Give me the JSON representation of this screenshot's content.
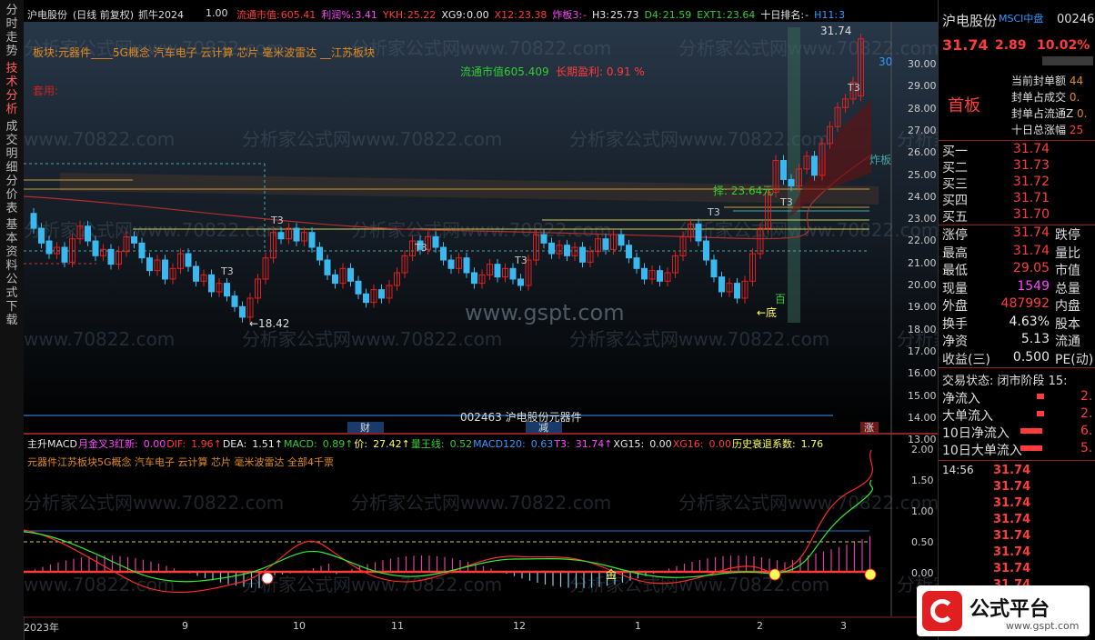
{
  "stock": {
    "name": "沪电股份",
    "code": "002463",
    "period": "(日线 前复权)",
    "indicator": "抓牛2024",
    "ratio": "1.00"
  },
  "header": {
    "items": [
      {
        "t": "流通市值:",
        "c": "#ff3c3c"
      },
      {
        "t": "605.41",
        "c": "#ff3c3c"
      },
      {
        "t": "利润%:",
        "c": "#ff44ff"
      },
      {
        "t": "3.41",
        "c": "#ff44ff"
      },
      {
        "t": "YKH:",
        "c": "#ff3c3c"
      },
      {
        "t": "25.22",
        "c": "#ff3c3c"
      },
      {
        "t": "XG9:",
        "c": "#e8e8e8"
      },
      {
        "t": "0.00",
        "c": "#e8e8e8"
      },
      {
        "t": "X12:",
        "c": "#ff3c3c"
      },
      {
        "t": "23.38",
        "c": "#ff3c3c"
      },
      {
        "t": "炸板3:",
        "c": "#ff44ff"
      },
      {
        "t": "-",
        "c": "#ff44ff"
      },
      {
        "t": "H3:",
        "c": "#e8e8e8"
      },
      {
        "t": "25.73",
        "c": "#e8e8e8"
      },
      {
        "t": "D4:",
        "c": "#33cc33"
      },
      {
        "t": "21.59",
        "c": "#33cc33"
      },
      {
        "t": "EXT1:",
        "c": "#33cc33"
      },
      {
        "t": "23.64",
        "c": "#33cc33"
      },
      {
        "t": "十日排名:",
        "c": "#e8e8e8"
      },
      {
        "t": "-",
        "c": "#e8e8e8"
      },
      {
        "t": "H11:",
        "c": "#3399ff"
      },
      {
        "t": "3",
        "c": "#3399ff"
      }
    ]
  },
  "main_text": {
    "concepts": "板块:元器件____5G概念 汽车电子 云计算 芯片 毫米波雷达 __江苏板块",
    "tag": "套用:",
    "circ_label": "流通市值605.409",
    "profit_label": "长期盈利: 0.91 %",
    "watermark": "分析家公式网www.70822.com",
    "gspt": "www.gspt.com",
    "t3": "T3",
    "low_label": "←18.42",
    "bottom_label": "←底",
    "bai": "百",
    "high_label": "31.74",
    "price30": "30",
    "zhaban": "炸板",
    "ze": "择: 23.64元",
    "tag_cai": "财",
    "tag_jian": "减",
    "tag_zhang": "涨",
    "code_label": "002463 沪电股份元器件"
  },
  "price_axis": [
    "30.00",
    "29.00",
    "28.00",
    "27.00",
    "26.00",
    "25.00",
    "24.00",
    "23.00",
    "22.00",
    "21.00",
    "20.00",
    "19.00",
    "18.00",
    "17.00",
    "16.00",
    "15.00",
    "14.00",
    "13.00"
  ],
  "macd_header": {
    "items": [
      {
        "t": "主升MACD",
        "c": "#e8e8e8"
      },
      {
        "t": "月金叉3红新:",
        "c": "#ff44ff"
      },
      {
        "t": "0.00",
        "c": "#ff44ff"
      },
      {
        "t": "DIF:",
        "c": "#ff3c3c"
      },
      {
        "t": "1.96↑",
        "c": "#ff3c3c"
      },
      {
        "t": "DEA:",
        "c": "#e8e8e8"
      },
      {
        "t": "1.51↑",
        "c": "#e8e8e8"
      },
      {
        "t": "MACD:",
        "c": "#33cc33"
      },
      {
        "t": "0.89↑",
        "c": "#33cc33"
      },
      {
        "t": "价:",
        "c": "#ffff55"
      },
      {
        "t": "27.42↑",
        "c": "#ffff55"
      },
      {
        "t": "量王线:",
        "c": "#33cc33"
      },
      {
        "t": "0.52",
        "c": "#33cc33"
      },
      {
        "t": "MACD120:",
        "c": "#3399ff"
      },
      {
        "t": "0.63",
        "c": "#3399ff"
      },
      {
        "t": "T3:",
        "c": "#ff44ff"
      },
      {
        "t": "31.74↑",
        "c": "#ff44ff"
      },
      {
        "t": "XG15:",
        "c": "#e8e8e8"
      },
      {
        "t": "0.00",
        "c": "#e8e8e8"
      },
      {
        "t": "XG16:",
        "c": "#ff3c3c"
      },
      {
        "t": "0.00",
        "c": "#ff3c3c"
      },
      {
        "t": "历史衰退系数:",
        "c": "#ffff55"
      },
      {
        "t": "1.76",
        "c": "#ffff55"
      }
    ],
    "sub": "元器件江苏板块5G概念 汽车电子 云计算 芯片 毫米波雷达 全部4千票",
    "jin": "金"
  },
  "macd_axis": [
    "2.00",
    "1.50",
    "1.00",
    "0.50",
    "0.00"
  ],
  "x_axis": [
    "2023年",
    "9",
    "10",
    "11",
    "12",
    "1",
    "2",
    "3"
  ],
  "sidebar": [
    "分时走势",
    "技术分析",
    "成交明细",
    "分价表",
    "基本资料",
    "公式下载"
  ],
  "right": {
    "name": "沪电股份",
    "index": "MSCI中盘",
    "code": "002463",
    "price": "31.74",
    "change": "2.89",
    "pct": "10.02%",
    "board": "首板",
    "seal_rows": [
      {
        "l": "当前封单额",
        "v": "44"
      },
      {
        "l": "封单占成交",
        "v": "0."
      },
      {
        "l": "封单占流通Z",
        "v": "0."
      },
      {
        "l": "十日总涨幅",
        "v": "25"
      }
    ],
    "bids": [
      {
        "l": "买一",
        "v": "31.74"
      },
      {
        "l": "买二",
        "v": "31.73"
      },
      {
        "l": "买三",
        "v": "31.72"
      },
      {
        "l": "买四",
        "v": "31.71"
      },
      {
        "l": "买五",
        "v": "31.70"
      }
    ],
    "stats": [
      {
        "l": "涨停",
        "v": "31.74",
        "c": "#ff3c3c",
        "l2": "跌停"
      },
      {
        "l": "最高",
        "v": "31.74",
        "c": "#ff3c3c",
        "l2": "量比"
      },
      {
        "l": "最低",
        "v": "29.05",
        "c": "#ff3c3c",
        "l2": "市值"
      },
      {
        "l": "现量",
        "v": "1549",
        "c": "#ff44ff",
        "l2": "总量"
      },
      {
        "l": "外盘",
        "v": "487992",
        "c": "#ff3c3c",
        "l2": "内盘"
      },
      {
        "l": "换手",
        "v": "4.63%",
        "c": "#e8e8e8",
        "l2": "股本"
      },
      {
        "l": "净资",
        "v": "5.13",
        "c": "#e8e8e8",
        "l2": "流通"
      },
      {
        "l": "收益(三)",
        "v": "0.500",
        "c": "#e8e8e8",
        "l2": "PE(动)"
      }
    ],
    "trade_state": "交易状态: 闭市阶段 15:",
    "flows": [
      {
        "l": "净流入",
        "v": "2."
      },
      {
        "l": "大单流入",
        "v": "2."
      },
      {
        "l": "10日净流入",
        "v": "6."
      },
      {
        "l": "10日大单流入",
        "v": "5."
      }
    ],
    "time": "14:56",
    "ticks": [
      "31.74",
      "31.74",
      "31.74",
      "31.74",
      "31.74",
      "31.74",
      "31.74",
      "31.74",
      "31.74",
      "31.74"
    ]
  },
  "logo": {
    "text": "公式平台",
    "url": "www.gspt.com"
  },
  "chart_data": {
    "type": "candlestick",
    "candles": [
      [
        23.5,
        22.8
      ],
      [
        22.8,
        22.1
      ],
      [
        22.2,
        21.6
      ],
      [
        21.6,
        21.9
      ],
      [
        21.9,
        21.2
      ],
      [
        21.2,
        22.3
      ],
      [
        22.3,
        22.9
      ],
      [
        22.9,
        22.2
      ],
      [
        22.2,
        21.5
      ],
      [
        21.5,
        21.8
      ],
      [
        21.8,
        21.1
      ],
      [
        21.1,
        21.7
      ],
      [
        21.7,
        22.4
      ],
      [
        22.4,
        22.1
      ],
      [
        22.1,
        21.4
      ],
      [
        21.4,
        20.8
      ],
      [
        20.8,
        21.3
      ],
      [
        21.3,
        20.4
      ],
      [
        20.4,
        20.9
      ],
      [
        20.9,
        21.6
      ],
      [
        21.6,
        21.0
      ],
      [
        21.0,
        20.3
      ],
      [
        20.3,
        20.6
      ],
      [
        20.6,
        19.8
      ],
      [
        19.8,
        20.2
      ],
      [
        20.2,
        19.6
      ],
      [
        19.6,
        19.1
      ],
      [
        19.1,
        18.6
      ],
      [
        18.6,
        19.5
      ],
      [
        19.5,
        20.4
      ],
      [
        20.4,
        21.4
      ],
      [
        21.4,
        22.6
      ],
      [
        22.6,
        22.3
      ],
      [
        22.3,
        22.8
      ],
      [
        22.8,
        22.2
      ],
      [
        22.2,
        22.6
      ],
      [
        22.6,
        21.9
      ],
      [
        21.9,
        21.3
      ],
      [
        21.3,
        20.6
      ],
      [
        20.6,
        20.2
      ],
      [
        20.2,
        20.9
      ],
      [
        20.9,
        20.3
      ],
      [
        20.3,
        19.7
      ],
      [
        19.7,
        19.3
      ],
      [
        19.3,
        19.9
      ],
      [
        19.9,
        19.5
      ],
      [
        19.5,
        20.1
      ],
      [
        20.1,
        20.7
      ],
      [
        20.7,
        21.5
      ],
      [
        21.5,
        22.2
      ],
      [
        22.2,
        21.8
      ],
      [
        21.8,
        22.4
      ],
      [
        22.4,
        21.9
      ],
      [
        21.9,
        21.3
      ],
      [
        21.3,
        20.9
      ],
      [
        20.9,
        21.4
      ],
      [
        21.4,
        20.7
      ],
      [
        20.7,
        20.2
      ],
      [
        20.2,
        20.6
      ],
      [
        20.6,
        21.1
      ],
      [
        21.1,
        20.5
      ],
      [
        20.5,
        20.9
      ],
      [
        20.9,
        20.4
      ],
      [
        20.4,
        20.1
      ],
      [
        20.1,
        21.3
      ],
      [
        21.3,
        22.5
      ],
      [
        22.5,
        22.1
      ],
      [
        22.1,
        21.6
      ],
      [
        21.6,
        22.0
      ],
      [
        22.0,
        21.5
      ],
      [
        21.5,
        21.9
      ],
      [
        21.9,
        21.2
      ],
      [
        21.2,
        21.7
      ],
      [
        21.7,
        22.3
      ],
      [
        22.3,
        21.8
      ],
      [
        21.8,
        22.5
      ],
      [
        22.5,
        22.0
      ],
      [
        22.0,
        21.4
      ],
      [
        21.4,
        20.9
      ],
      [
        20.9,
        20.4
      ],
      [
        20.4,
        20.8
      ],
      [
        20.8,
        20.3
      ],
      [
        20.3,
        20.7
      ],
      [
        20.7,
        21.5
      ],
      [
        21.5,
        22.4
      ],
      [
        22.4,
        23.0
      ],
      [
        23.0,
        22.2
      ],
      [
        22.2,
        21.3
      ],
      [
        21.3,
        20.5
      ],
      [
        20.5,
        19.8
      ],
      [
        19.8,
        20.2
      ],
      [
        20.2,
        19.5
      ],
      [
        19.5,
        20.3
      ],
      [
        20.3,
        21.6
      ],
      [
        21.6,
        22.8
      ],
      [
        22.8,
        24.5
      ],
      [
        24.5,
        26.0
      ],
      [
        26.0,
        25.1
      ],
      [
        25.1,
        24.8
      ],
      [
        24.8,
        25.6
      ],
      [
        25.6,
        26.2
      ],
      [
        26.2,
        25.3
      ],
      [
        25.3,
        26.8
      ],
      [
        26.8,
        27.6
      ],
      [
        27.6,
        28.5
      ],
      [
        28.5,
        28.9
      ],
      [
        28.9,
        29.7
      ],
      [
        29.05,
        31.74
      ]
    ]
  }
}
